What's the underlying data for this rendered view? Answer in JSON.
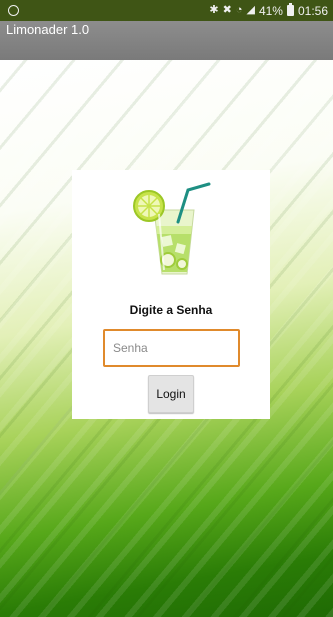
{
  "status_bar": {
    "left_icon": "whatsapp-icon",
    "icons": [
      "bluetooth-icon",
      "mute-icon",
      "wifi-icon",
      "signal-icon"
    ],
    "battery_percent": "41%",
    "battery_icon": "battery-icon",
    "time": "01:56"
  },
  "app_bar": {
    "title": "Limonader 1.0"
  },
  "login_card": {
    "image": "lemonade-glass-icon",
    "prompt": "Digite a Senha",
    "password": {
      "value": "",
      "placeholder": "Senha"
    },
    "login_label": "Login"
  },
  "colors": {
    "status_bar": "#3f5515",
    "title_bar": "#858585",
    "input_border": "#e08a2c",
    "background_green": "#2a7c06"
  }
}
